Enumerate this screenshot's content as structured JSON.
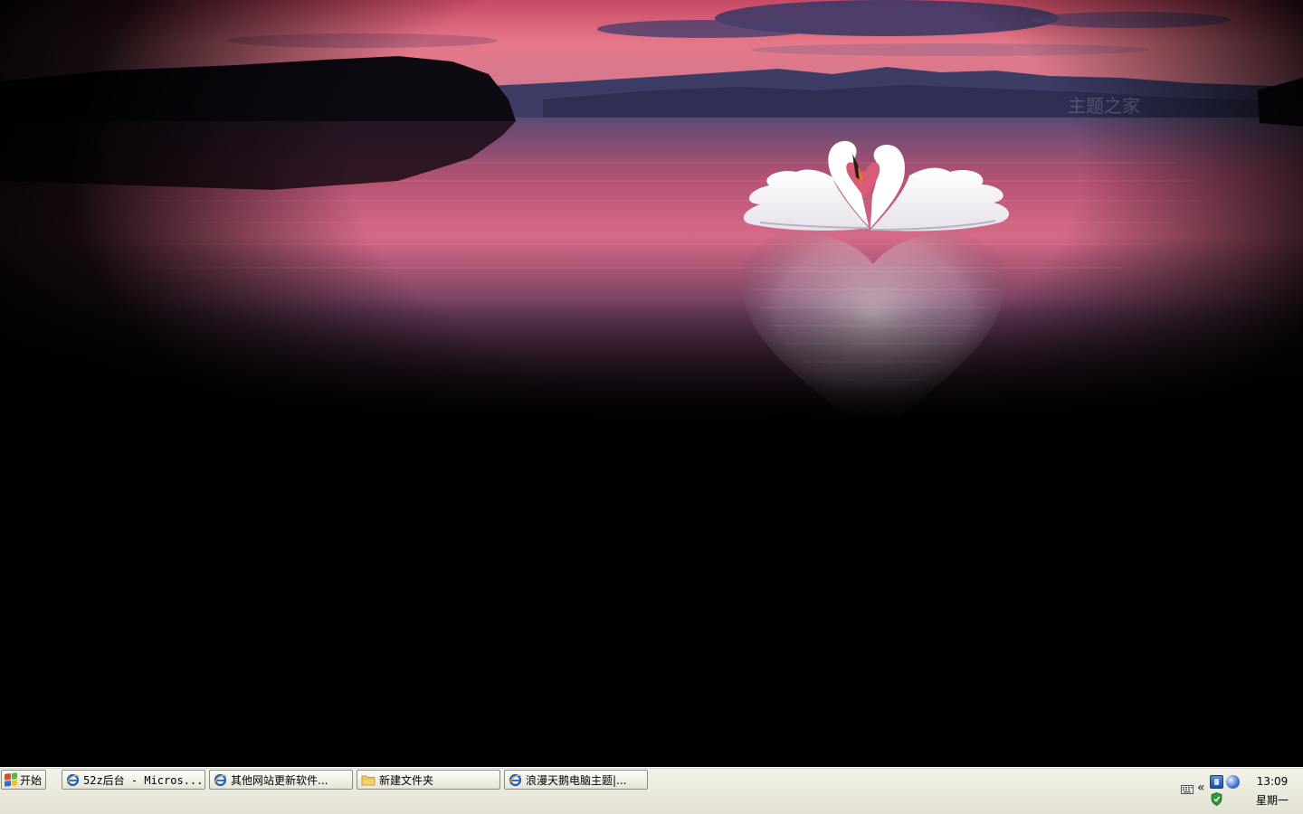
{
  "desktop": {
    "wallpaper_watermark": "主题之家"
  },
  "start": {
    "label": "开始"
  },
  "taskbar": {
    "items": [
      {
        "label": "52z后台 - Micros...",
        "icon": "ie-icon"
      },
      {
        "label": "其他网站更新软件...",
        "icon": "ie-icon"
      },
      {
        "label": "新建文件夹",
        "icon": "folder-icon"
      },
      {
        "label": "浪漫天鹅电脑主题|...",
        "icon": "ie-icon"
      }
    ]
  },
  "tray": {
    "time": "13:09",
    "day": "星期一",
    "chevron": "«",
    "icons": [
      "keyboard-icon",
      "network-icon",
      "messenger-icon",
      "shield-icon"
    ]
  },
  "colors": {
    "taskbar_bg": "#ecebe0",
    "sky_pink": "#e0607a",
    "sky_purple": "#3c3660",
    "water_pink": "#c9536e"
  }
}
